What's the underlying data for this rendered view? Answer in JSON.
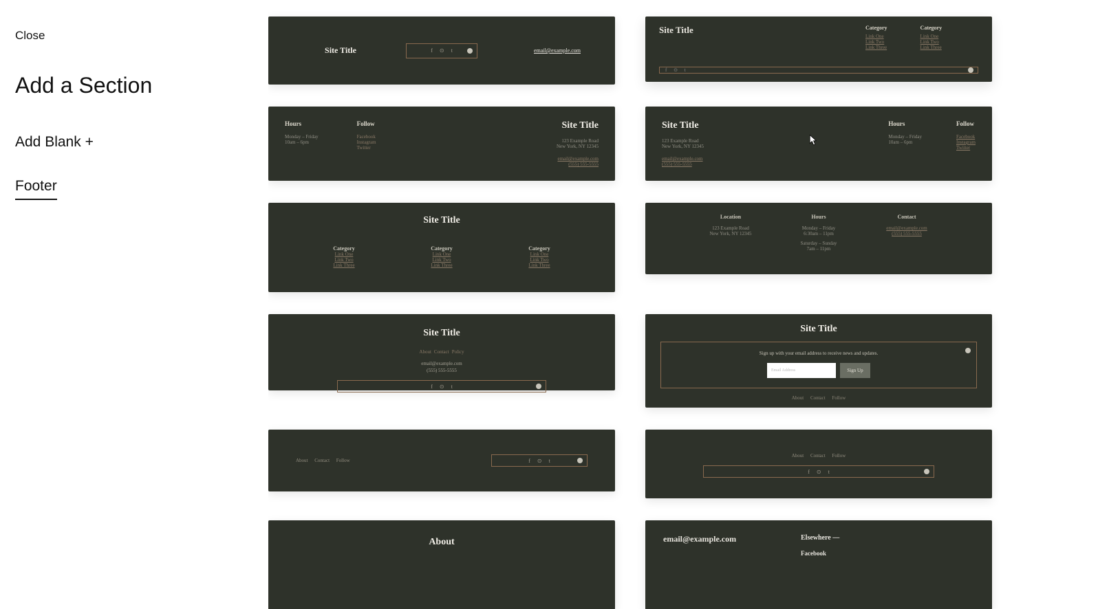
{
  "sidebar": {
    "close": "Close",
    "title": "Add a Section",
    "addBlank": "Add Blank +",
    "footer": "Footer"
  },
  "common": {
    "siteTitle": "Site Title",
    "email": "email@example.com",
    "phone": "(555) 555-5555",
    "address1": "123 Example Road",
    "address2": "New York, NY 12345",
    "category": "Category",
    "linkOne": "Link One",
    "linkTwo": "Link Two",
    "linkThree": "Link Three",
    "hours": "Hours",
    "follow": "Follow",
    "monFri": "Monday – Friday",
    "tenToSix": "10am – 6pm",
    "satSun": "Saturday – Sunday",
    "sixThirtyEleven": "6:30am – 11pm",
    "sevenEleven": "7am – 11pm",
    "location": "Location",
    "contact": "Contact",
    "facebook": "Facebook",
    "instagram": "Instagram",
    "twitter": "Twitter",
    "about": "About",
    "contactNav": "Contact",
    "policy": "Policy",
    "followNav": "Follow",
    "signupText": "Sign up with your email address to receive news and updates.",
    "emailPlaceholder": "Email Address",
    "signUp": "Sign Up",
    "elsewhere": "Elsewhere —"
  }
}
